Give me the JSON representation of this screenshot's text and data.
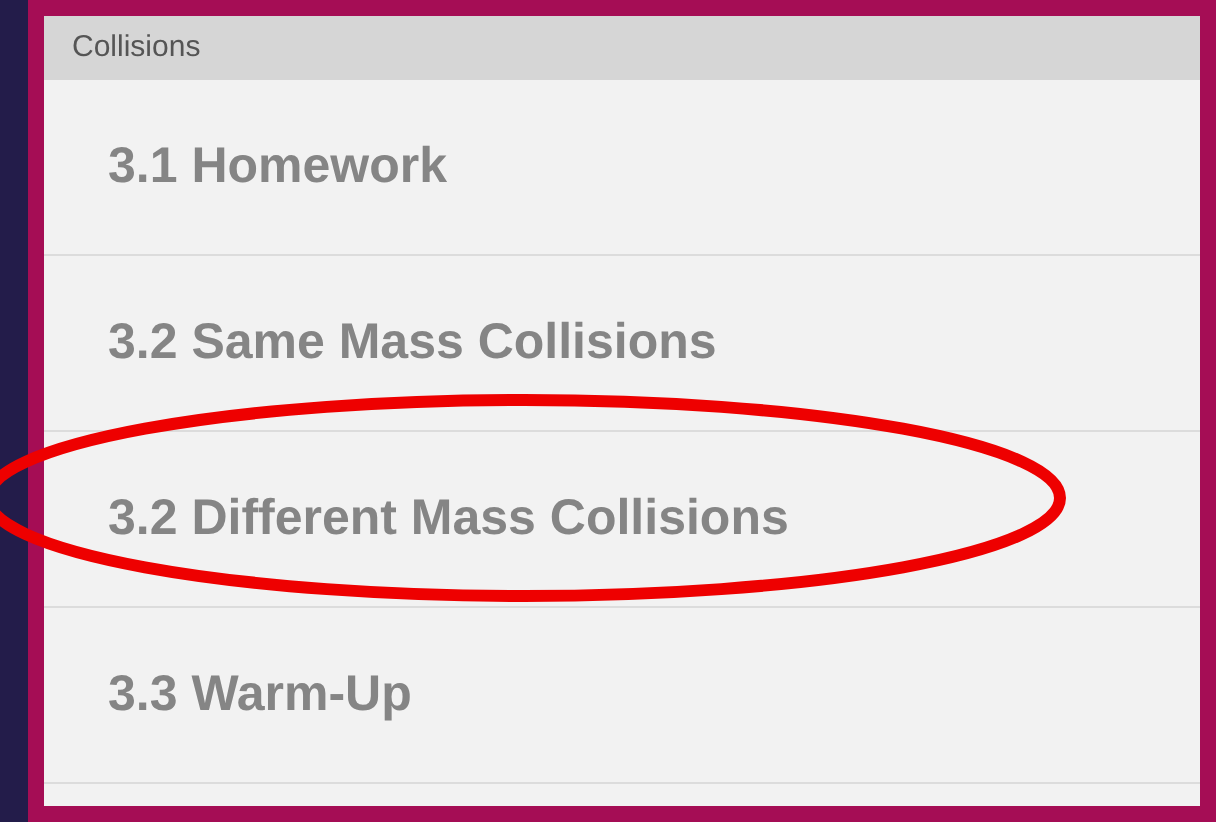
{
  "section": {
    "title": "Collisions"
  },
  "items": [
    {
      "label": "3.1 Homework",
      "highlighted": false
    },
    {
      "label": "3.2 Same Mass Collisions",
      "highlighted": false
    },
    {
      "label": "3.2 Different Mass Collisions",
      "highlighted": true
    },
    {
      "label": "3.3 Warm-Up",
      "highlighted": false
    }
  ]
}
